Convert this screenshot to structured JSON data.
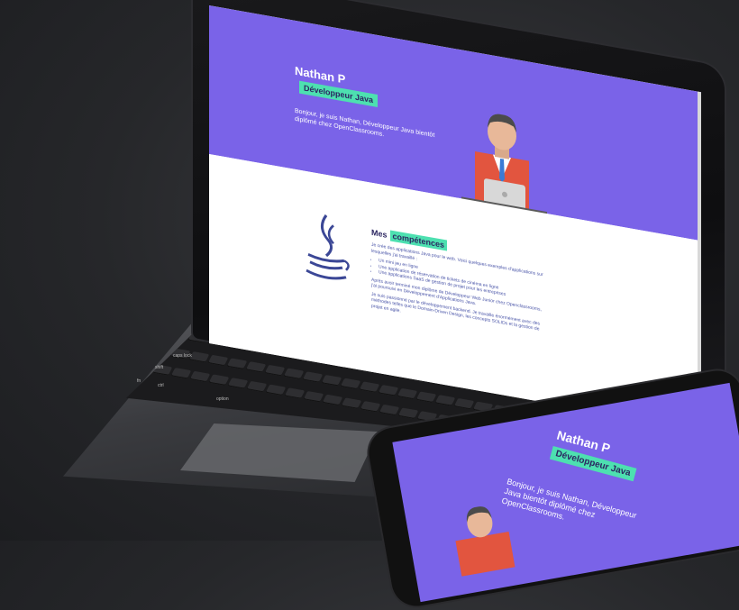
{
  "site": {
    "hero": {
      "name": "Nathan P",
      "role_badge": "Développeur Java",
      "intro": "Bonjour, je suis Nathan, Développeur Java bientôt diplômé chez OpenClassrooms."
    },
    "skills": {
      "title_prefix": "Mes",
      "title_badge": "compétences",
      "paragraph_1": "Je crée des applications Java pour le web. Voici quelques exemples d'applications sur lesquelles j'ai travaillé :",
      "items": [
        "Un mini jeu en ligne",
        "Une application de réservation de tickets de cinéma en ligne",
        "Une applications SaaS de gestion de projet pour les entreprises"
      ],
      "paragraph_2": "Après avoir terminé mon diplôme de Développeur Web Junior chez Openclassrooms, j'ai poursuivi en Développement d'Applications Java.",
      "paragraph_3": "Je suis passionné par le développement backend. Je travaille énormément avec des méthodes telles que le Domain-Driven Design, les concepts SOLIDs et la gestion de projet en agile."
    }
  },
  "keyboard": {
    "labels": [
      "caps lock",
      "shift",
      "ctrl",
      "fn",
      "option",
      "delete"
    ]
  },
  "phone": {
    "name": "Nathan P",
    "role_badge": "Développeur Java",
    "intro": "Bonjour, je suis Nathan, Développeur Java bientôt diplômé chez OpenClassrooms."
  },
  "colors": {
    "hero_purple": "#7a63e8",
    "badge_green": "#4de0b0",
    "text_navy": "#2b2560"
  }
}
